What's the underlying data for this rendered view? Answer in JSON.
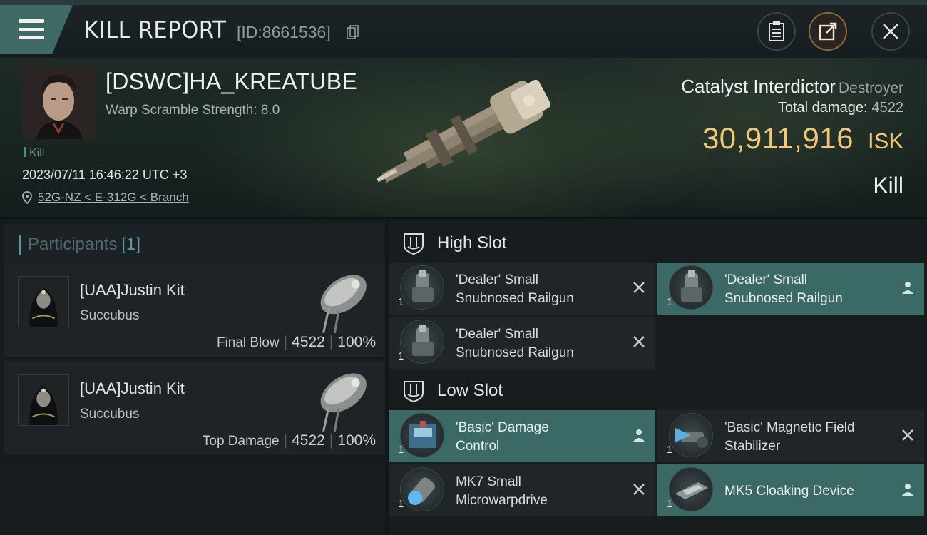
{
  "header": {
    "title": "KILL REPORT",
    "report_id": "[ID:8661536]"
  },
  "victim": {
    "name": "[DSWC]HA_KREATUBE",
    "warp_scramble": "Warp Scramble Strength: 8.0",
    "tag": "Kill",
    "datetime": "2023/07/11 16:46:22 UTC +3",
    "location": "52G-NZ < E-312G < Branch",
    "ship_name": "Catalyst Interdictor",
    "ship_class": "Destroyer",
    "total_damage_label": "Total damage:",
    "total_damage": "4522",
    "isk_value": "30,911,916",
    "isk_currency": "ISK",
    "result": "Kill"
  },
  "participants": {
    "label": "Participants",
    "count": "[1]",
    "items": [
      {
        "name": "[UAA]Justin Kit",
        "ship": "Succubus",
        "role": "Final Blow",
        "damage": "4522",
        "percent": "100%"
      },
      {
        "name": "[UAA]Justin Kit",
        "ship": "Succubus",
        "role": "Top Damage",
        "damage": "4522",
        "percent": "100%"
      }
    ],
    "separator": "|"
  },
  "fitting": {
    "high_slot_label": "High Slot",
    "low_slot_label": "Low Slot",
    "high": [
      {
        "line1": "'Dealer' Small",
        "line2": "Snubnosed Railgun",
        "qty": "1",
        "status": "destroyed"
      },
      {
        "line1": "'Dealer' Small",
        "line2": "Snubnosed Railgun",
        "qty": "1",
        "status": "dropped"
      },
      {
        "line1": "'Dealer' Small",
        "line2": "Snubnosed Railgun",
        "qty": "1",
        "status": "destroyed"
      }
    ],
    "low": [
      {
        "line1": "'Basic' Damage",
        "line2": "Control",
        "qty": "1",
        "status": "dropped"
      },
      {
        "line1": "'Basic' Magnetic Field",
        "line2": "Stabilizer",
        "qty": "1",
        "status": "destroyed"
      },
      {
        "line1": "MK7 Small",
        "line2": "Microwarpdrive",
        "qty": "1",
        "status": "destroyed"
      },
      {
        "line1": "MK5 Cloaking Device",
        "line2": "",
        "qty": "1",
        "status": "dropped"
      }
    ]
  },
  "colors": {
    "accent_teal": "#3b6a66",
    "isk_gold": "#f2c878",
    "background": "#12171a"
  }
}
